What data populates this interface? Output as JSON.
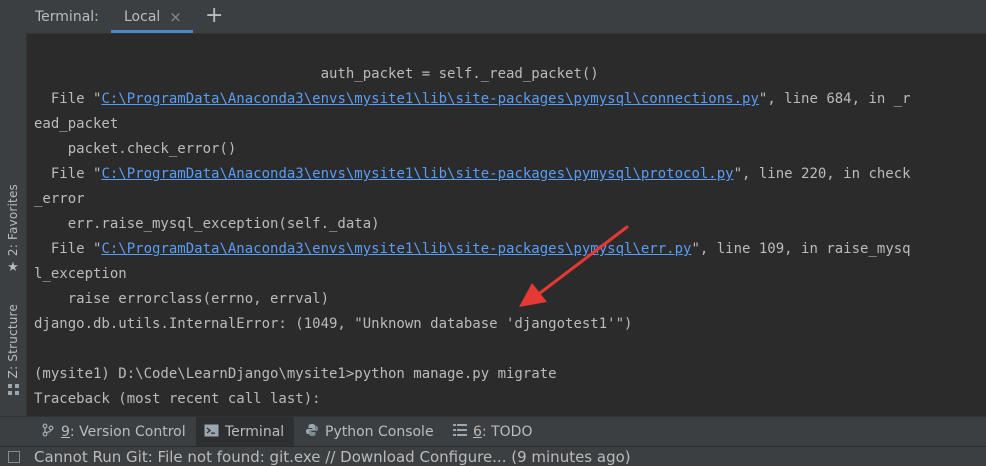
{
  "header": {
    "title": "Terminal:",
    "tab_label": "Local",
    "close_glyph": "×",
    "add_glyph": "+"
  },
  "left_strip": {
    "favorites_label": "2: Favorites",
    "favorites_icon": "star-icon",
    "structure_label": "Z: Structure",
    "structure_icon": "structure-icon"
  },
  "terminal": {
    "line_01": "                                  auth_packet = self._read_packet()",
    "line_02_pre": "  File \"",
    "line_02_link": "C:\\ProgramData\\Anaconda3\\envs\\mysite1\\lib\\site-packages\\pymysql\\connections.py",
    "line_02_post": "\", line 684, in _r",
    "line_03": "ead_packet",
    "line_04": "    packet.check_error()",
    "line_05_pre": "  File \"",
    "line_05_link": "C:\\ProgramData\\Anaconda3\\envs\\mysite1\\lib\\site-packages\\pymysql\\protocol.py",
    "line_05_post": "\", line 220, in check",
    "line_06": "_error",
    "line_07": "    err.raise_mysql_exception(self._data)",
    "line_08_pre": "  File \"",
    "line_08_link": "C:\\ProgramData\\Anaconda3\\envs\\mysite1\\lib\\site-packages\\pymysql\\err.py",
    "line_08_post": "\", line 109, in raise_mysq",
    "line_09": "l_exception",
    "line_10": "    raise errorclass(errno, errval)",
    "line_11": "django.db.utils.InternalError: (1049, \"Unknown database 'djangotest1'\")",
    "line_12": "",
    "line_13": "(mysite1) D:\\Code\\LearnDjango\\mysite1>python manage.py migrate",
    "line_14": "Traceback (most recent call last):"
  },
  "bottom_bar": {
    "version_control_key": "9",
    "version_control_label": ": Version Control",
    "terminal_label": "Terminal",
    "python_console_label": "Python Console",
    "todo_key": "6",
    "todo_label": ": TODO"
  },
  "status": {
    "text": "Cannot Run Git: File not found: git.exe // Download   Configure... (9 minutes ago)"
  },
  "colors": {
    "background": "#2b2b2b",
    "panel": "#3c3f41",
    "link": "#589df6",
    "accent": "#4a88c7",
    "arrow": "#e53935"
  }
}
